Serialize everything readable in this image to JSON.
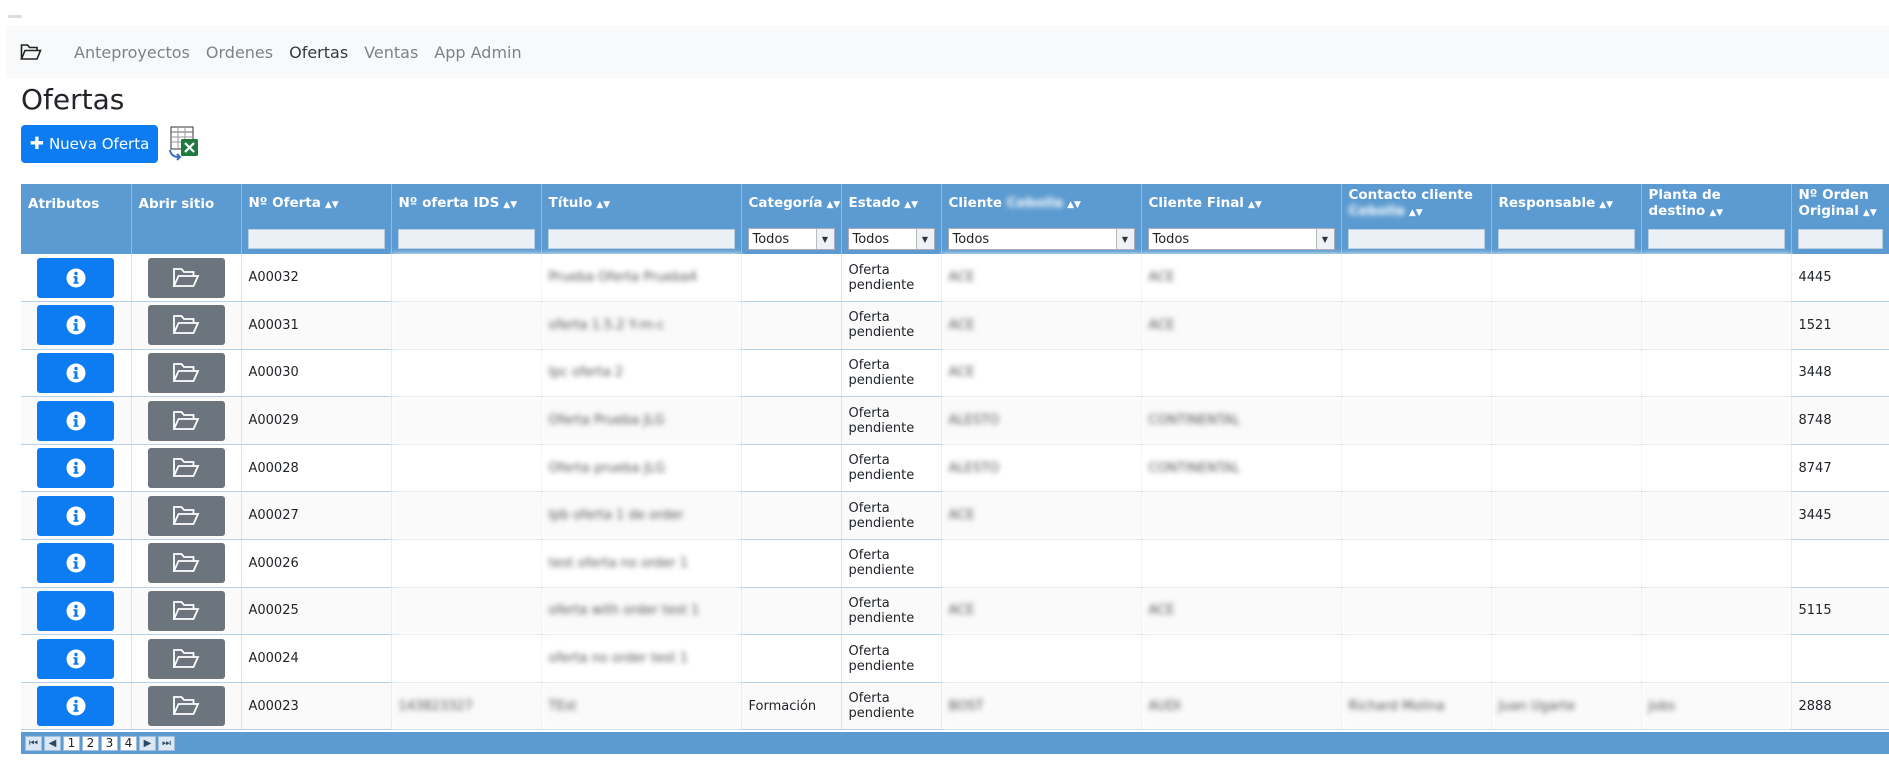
{
  "nav": {
    "items": [
      {
        "label": "Anteproyectos",
        "active": false
      },
      {
        "label": "Ordenes",
        "active": false
      },
      {
        "label": "Ofertas",
        "active": true
      },
      {
        "label": "Ventas",
        "active": false
      },
      {
        "label": "App Admin",
        "active": false
      }
    ]
  },
  "page": {
    "title": "Ofertas",
    "new_button": "Nueva Oferta"
  },
  "table": {
    "columns": [
      {
        "label": "Atributos",
        "sortable": false
      },
      {
        "label": "Abrir sitio",
        "sortable": false
      },
      {
        "label": "Nº Oferta",
        "sortable": true
      },
      {
        "label": "Nº oferta IDS",
        "sortable": true
      },
      {
        "label": "Título",
        "sortable": true
      },
      {
        "label": "Categoría",
        "sortable": true
      },
      {
        "label": "Estado",
        "sortable": true
      },
      {
        "label": "Cliente",
        "sortable": true,
        "blurred_suffix": "Cebolla"
      },
      {
        "label": "Cliente Final",
        "sortable": true
      },
      {
        "label": "Contacto cliente",
        "sortable": true,
        "blurred_suffix": "Cebolla"
      },
      {
        "label": "Responsable",
        "sortable": true
      },
      {
        "label": "Planta de destino",
        "sortable": true
      },
      {
        "label": "Nº Orden Original",
        "sortable": true
      }
    ],
    "filters": {
      "categoria": "Todos",
      "estado": "Todos",
      "cliente": "Todos",
      "cliente_final": "Todos"
    },
    "rows": [
      {
        "oferta": "A00032",
        "ids": "",
        "titulo": "Prueba Oferta Prueba4",
        "categoria": "",
        "estado": "Oferta pendiente",
        "cliente": "ACE",
        "cliente_final": "ACE",
        "contacto": "",
        "responsable": "",
        "planta": "",
        "orden": "4445"
      },
      {
        "oferta": "A00031",
        "ids": "",
        "titulo": "oferta 1.5.2 Y-m-c",
        "categoria": "",
        "estado": "Oferta pendiente",
        "cliente": "ACE",
        "cliente_final": "ACE",
        "contacto": "",
        "responsable": "",
        "planta": "",
        "orden": "1521"
      },
      {
        "oferta": "A00030",
        "ids": "",
        "titulo": "Ipc oferta 2",
        "categoria": "",
        "estado": "Oferta pendiente",
        "cliente": "ACE",
        "cliente_final": "",
        "contacto": "",
        "responsable": "",
        "planta": "",
        "orden": "3448"
      },
      {
        "oferta": "A00029",
        "ids": "",
        "titulo": "Oferta Prueba JLG",
        "categoria": "",
        "estado": "Oferta pendiente",
        "cliente": "ALESTO",
        "cliente_final": "CONTINENTAL",
        "contacto": "",
        "responsable": "",
        "planta": "",
        "orden": "8748"
      },
      {
        "oferta": "A00028",
        "ids": "",
        "titulo": "Oferta prueba JLG",
        "categoria": "",
        "estado": "Oferta pendiente",
        "cliente": "ALESTO",
        "cliente_final": "CONTINENTAL",
        "contacto": "",
        "responsable": "",
        "planta": "",
        "orden": "8747"
      },
      {
        "oferta": "A00027",
        "ids": "",
        "titulo": "Ipb oferta 1 de order",
        "categoria": "",
        "estado": "Oferta pendiente",
        "cliente": "ACE",
        "cliente_final": "",
        "contacto": "",
        "responsable": "",
        "planta": "",
        "orden": "3445"
      },
      {
        "oferta": "A00026",
        "ids": "",
        "titulo": "test oferta no order 1",
        "categoria": "",
        "estado": "Oferta pendiente",
        "cliente": "",
        "cliente_final": "",
        "contacto": "",
        "responsable": "",
        "planta": "",
        "orden": ""
      },
      {
        "oferta": "A00025",
        "ids": "",
        "titulo": "oferta with order test 1",
        "categoria": "",
        "estado": "Oferta pendiente",
        "cliente": "ACE",
        "cliente_final": "ACE",
        "contacto": "",
        "responsable": "",
        "planta": "",
        "orden": "5115"
      },
      {
        "oferta": "A00024",
        "ids": "",
        "titulo": "oferta no order test 1",
        "categoria": "",
        "estado": "Oferta pendiente",
        "cliente": "",
        "cliente_final": "",
        "contacto": "",
        "responsable": "",
        "planta": "",
        "orden": ""
      },
      {
        "oferta": "A00023",
        "ids": "143823327",
        "titulo": "TEst",
        "categoria": "Formación",
        "estado": "Oferta pendiente",
        "cliente": "BOST",
        "cliente_final": "AUDI",
        "contacto": "Richard Molina",
        "responsable": "Juan Ugarte",
        "planta": "Jobs",
        "orden": "2888"
      }
    ]
  },
  "pagination": {
    "pages": [
      "1",
      "2",
      "3",
      "4"
    ],
    "current": "1"
  },
  "colors": {
    "primary": "#0d7cf2",
    "secondary": "#6c757d",
    "grid_header": "#5b9bd1"
  }
}
